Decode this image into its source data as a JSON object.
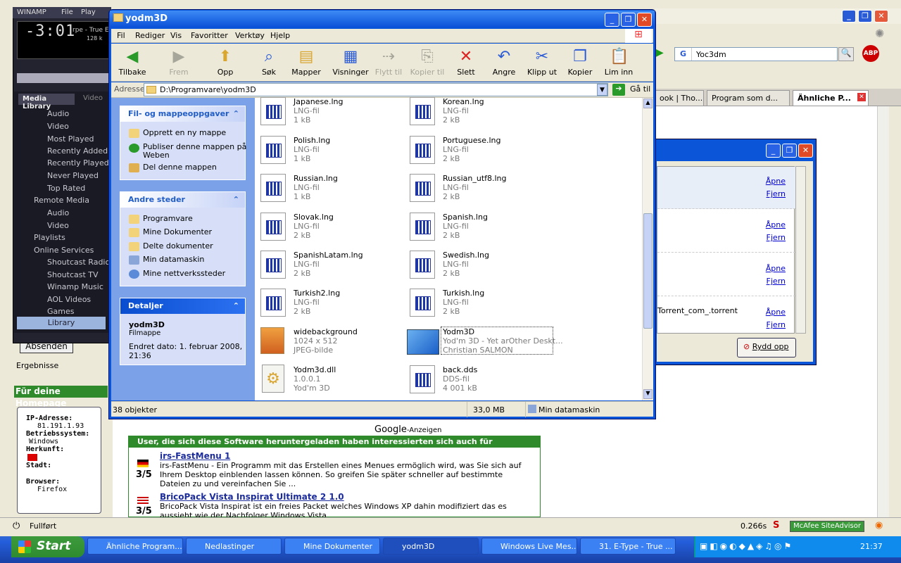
{
  "firefox": {
    "search_value": "Yoc3dm",
    "search_engine": "G",
    "tabs": [
      "ook | Tho...",
      "Program som d...",
      "Ähnliche P..."
    ],
    "status": "Fullført",
    "status_time": "0.266s",
    "mcafee": "McAfee SiteAdvisor",
    "abp": "ABP",
    "page": {
      "absenden": "Absenden",
      "ergebnisse": "Ergebnisse",
      "homepage_title": "Für deine Homepage",
      "ip_label": "IP-Adresse:",
      "ip_value": "81.191.1.93",
      "os_label": "Betriebssystem:",
      "os_value": "Windows",
      "origin_label": "Herkunft:",
      "city_label": "Stadt:",
      "browser_label": "Browser:",
      "browser_value": "Firefox",
      "google_ads": "Google",
      "google_ads_suffix": "-Anzeigen",
      "ad_header": "User, die sich diese Software heruntergeladen haben interessierten sich auch für",
      "ads": [
        {
          "title": "irs-FastMenu 1",
          "rating": "3/5",
          "text1": "irs-FastMenu - Ein Programm mit das Erstellen eines Menues ermöglich wird, was Sie sich auf",
          "text2": "Ihrem Desktop einblenden lassen können. So greifen Sie später schneller auf bestimmte",
          "text3": "Dateien zu und vereinfachen Sie ..."
        },
        {
          "title": "BricoPack Vista Inspirat Ultimate 2 1.0",
          "rating": "3/5",
          "text1": "BricoPack Vista Inspirat ist ein freies Packet welches Windows XP dahin modifiziert das es",
          "text2": "aussieht wie der Nachfolger Windows Vista"
        }
      ]
    }
  },
  "downloads": {
    "open_label": "Åpne",
    "remove_label": "Fjern",
    "torrent_name": "Torrent_com_.torrent",
    "clear_button": "Rydd opp"
  },
  "winamp": {
    "title": "WINAMP",
    "menu": [
      "File",
      "Play"
    ],
    "time": "-3:01",
    "track": "rpe - True E",
    "bitrate": "128 k",
    "tab_active": "Media Library",
    "tab_other": "Video",
    "items": [
      "Audio",
      "Video",
      "Most Played",
      "Recently Added",
      "Recently Played",
      "Never Played",
      "Top Rated",
      "Remote Media",
      "Audio",
      "Video",
      "Playlists",
      "Online Services",
      "Shoutcast Radio",
      "Shoutcast TV",
      "Winamp Music",
      "AOL Videos",
      "Games"
    ],
    "library_button": "Library"
  },
  "explorer": {
    "title": "yodm3D",
    "menu": [
      "Fil",
      "Rediger",
      "Vis",
      "Favoritter",
      "Verktøy",
      "Hjelp"
    ],
    "toolbar": [
      "Tilbake",
      "Frem",
      "Opp",
      "Søk",
      "Mapper",
      "Visninger",
      "Flytt til",
      "Kopier til",
      "Slett",
      "Angre",
      "Klipp ut",
      "Kopier",
      "Lim inn"
    ],
    "address_label": "Adresse",
    "address_value": "D:\\Programvare\\yodm3D",
    "go_label": "Gå til",
    "tasks": {
      "title": "Fil- og mappeoppgaver",
      "items": [
        "Opprett en ny mappe",
        "Publiser denne mappen på",
        "Weben",
        "Del denne mappen"
      ]
    },
    "other_places": {
      "title": "Andre steder",
      "items": [
        "Programvare",
        "Mine Dokumenter",
        "Delte dokumenter",
        "Min datamaskin",
        "Mine nettverkssteder"
      ]
    },
    "details": {
      "title": "Detaljer",
      "name": "yodm3D",
      "type": "Filmappe",
      "modified1": "Endret dato: 1. februar 2008,",
      "modified2": "21:36"
    },
    "files": [
      {
        "name": "Japanese.lng",
        "type": "LNG-fil",
        "size": "1 kB"
      },
      {
        "name": "Korean.lng",
        "type": "LNG-fil",
        "size": "2 kB"
      },
      {
        "name": "Polish.lng",
        "type": "LNG-fil",
        "size": "1 kB"
      },
      {
        "name": "Portuguese.lng",
        "type": "LNG-fil",
        "size": "2 kB"
      },
      {
        "name": "Russian.lng",
        "type": "LNG-fil",
        "size": "1 kB"
      },
      {
        "name": "Russian_utf8.lng",
        "type": "LNG-fil",
        "size": "2 kB"
      },
      {
        "name": "Slovak.lng",
        "type": "LNG-fil",
        "size": "2 kB"
      },
      {
        "name": "Spanish.lng",
        "type": "LNG-fil",
        "size": "2 kB"
      },
      {
        "name": "SpanishLatam.lng",
        "type": "LNG-fil",
        "size": "2 kB"
      },
      {
        "name": "Swedish.lng",
        "type": "LNG-fil",
        "size": "2 kB"
      },
      {
        "name": "Turkish2.lng",
        "type": "LNG-fil",
        "size": "2 kB"
      },
      {
        "name": "Turkish.lng",
        "type": "LNG-fil",
        "size": "2 kB"
      },
      {
        "name": "widebackground",
        "type": "1024 x 512",
        "size": "JPEG-bilde"
      },
      {
        "name": "Yodm3D",
        "type": "Yod'm 3D - Yet arOther Deskt...",
        "size": "Christian SALMON"
      },
      {
        "name": "Yodm3d.dll",
        "type": "1.0.0.1",
        "size": "Yod'm 3D"
      },
      {
        "name": "back.dds",
        "type": "DDS-fil",
        "size": "4 001 kB"
      }
    ],
    "status_count": "38 objekter",
    "status_size": "33,0 MB",
    "status_location": "Min datamaskin"
  },
  "taskbar": {
    "start": "Start",
    "buttons": [
      "Ähnliche Program...",
      "Nedlastinger",
      "Mine Dokumenter",
      "yodm3D",
      "Windows Live Mes...",
      "31. E-Type - True ..."
    ],
    "clock": "21:37"
  }
}
